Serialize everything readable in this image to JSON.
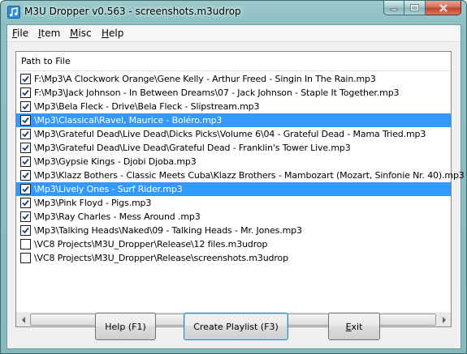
{
  "window": {
    "title": "M3U Dropper v0.563 - screenshots.m3udrop"
  },
  "menu": {
    "items": [
      "File",
      "Item",
      "Misc",
      "Help"
    ]
  },
  "list": {
    "column_header": "Path to File",
    "rows": [
      {
        "path": "F:\\Mp3\\A Clockwork Orange\\Gene Kelly - Arthur Freed - Singin In The Rain.mp3",
        "checked": true,
        "selected": false
      },
      {
        "path": "F:\\Mp3\\Jack Johnson - In Between Dreams\\07 - Jack Johnson - Staple It Together.mp3",
        "checked": true,
        "selected": false
      },
      {
        "path": "\\Mp3\\Bela Fleck - Drive\\Bela Fleck - Slipstream.mp3",
        "checked": true,
        "selected": false
      },
      {
        "path": "\\Mp3\\Classical\\Ravel, Maurice - Boléro.mp3",
        "checked": true,
        "selected": true
      },
      {
        "path": "\\Mp3\\Grateful Dead\\Live Dead\\Dicks Picks\\Volume 6\\04 - Grateful Dead - Mama Tried.mp3",
        "checked": true,
        "selected": false
      },
      {
        "path": "\\Mp3\\Grateful Dead\\Live Dead\\Grateful Dead - Franklin's Tower Live.mp3",
        "checked": true,
        "selected": false
      },
      {
        "path": "\\Mp3\\Gypsie Kings - Djobi Djoba.mp3",
        "checked": true,
        "selected": false
      },
      {
        "path": "\\Mp3\\Klazz Bothers - Classic Meets Cuba\\Klazz Brothers - Mambozart (Mozart, Sinfonie Nr. 40).mp3",
        "checked": true,
        "selected": false
      },
      {
        "path": "\\Mp3\\Lively Ones - Surf Rider.mp3",
        "checked": true,
        "selected": true
      },
      {
        "path": "\\Mp3\\Pink Floyd - Pigs.mp3",
        "checked": true,
        "selected": false
      },
      {
        "path": "\\Mp3\\Ray Charles - Mess Around .mp3",
        "checked": true,
        "selected": false
      },
      {
        "path": "\\Mp3\\Talking Heads\\Naked\\09 - Talking Heads - Mr. Jones.mp3",
        "checked": true,
        "selected": false
      },
      {
        "path": "\\VC8 Projects\\M3U_Dropper\\Release\\12 files.m3udrop",
        "checked": false,
        "selected": false
      },
      {
        "path": "\\VC8 Projects\\M3U_Dropper\\Release\\screenshots.m3udrop",
        "checked": false,
        "selected": false
      }
    ]
  },
  "buttons": {
    "help": "Help (F1)",
    "create": "Create Playlist (F3)",
    "exit": "Exit"
  },
  "colors": {
    "selection": "#3399ff",
    "frame": "#8dbfc2"
  },
  "icons": {
    "app": "music-note-icon",
    "minimize": "minimize-icon",
    "maximize": "maximize-icon",
    "close": "close-icon"
  }
}
